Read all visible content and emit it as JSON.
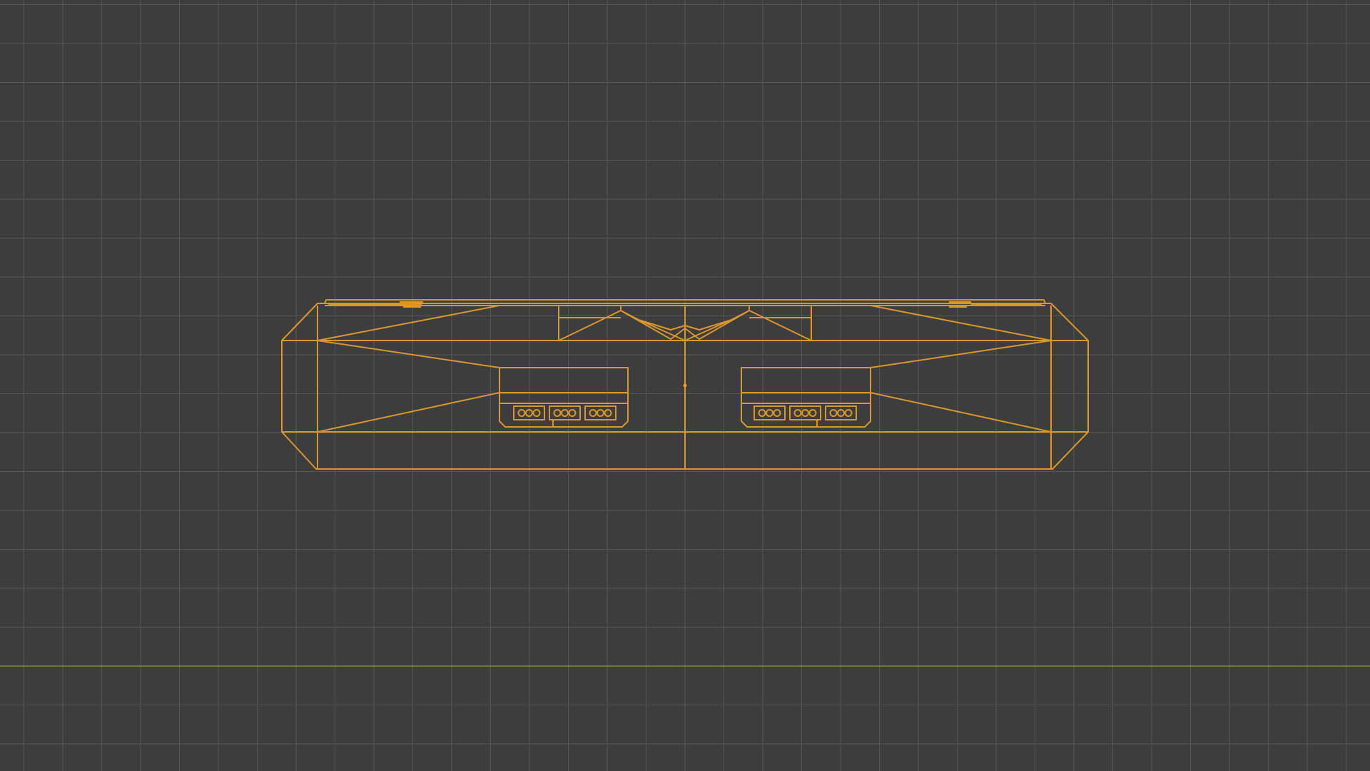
{
  "viewport": {
    "view": "wireframe-orthographic",
    "grid_visible": true,
    "colors": {
      "background": "#3d3d3d",
      "grid_line": "#565656",
      "horizon_axis": "#7f8a3c",
      "wireframe_selected": "#d9952e",
      "origin_dot": "#e8a040"
    },
    "selected_object": {
      "name_visible": false,
      "selected": true
    }
  }
}
